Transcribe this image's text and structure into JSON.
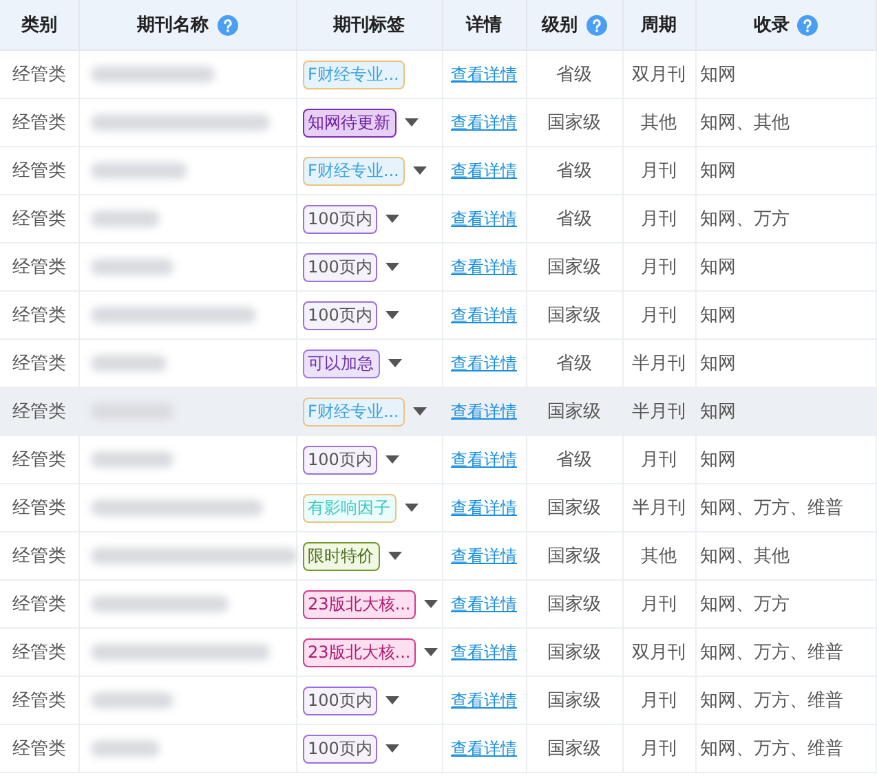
{
  "columns": [
    {
      "label": "类别",
      "help": false
    },
    {
      "label": "期刊名称",
      "help": true
    },
    {
      "label": "期刊标签",
      "help": false
    },
    {
      "label": "详情",
      "help": false
    },
    {
      "label": "级别",
      "help": true
    },
    {
      "label": "周期",
      "help": false
    },
    {
      "label": "收录",
      "help": true
    }
  ],
  "rows": [
    {
      "category": "经管类",
      "tag": {
        "text": "F财经专业...",
        "kind": "finance",
        "menu": false
      },
      "detail": "查看详情",
      "level": "省级",
      "period": "双月刊",
      "index": "知网",
      "hovered": false
    },
    {
      "category": "经管类",
      "tag": {
        "text": "知网待更新",
        "kind": "update",
        "menu": true
      },
      "detail": "查看详情",
      "level": "国家级",
      "period": "其他",
      "index": "知网、其他",
      "hovered": false
    },
    {
      "category": "经管类",
      "tag": {
        "text": "F财经专业...",
        "kind": "finance",
        "menu": true
      },
      "detail": "查看详情",
      "level": "省级",
      "period": "月刊",
      "index": "知网",
      "hovered": false
    },
    {
      "category": "经管类",
      "tag": {
        "text": "100页内",
        "kind": "pages",
        "menu": true
      },
      "detail": "查看详情",
      "level": "省级",
      "period": "月刊",
      "index": "知网、万方",
      "hovered": false
    },
    {
      "category": "经管类",
      "tag": {
        "text": "100页内",
        "kind": "pages",
        "menu": true
      },
      "detail": "查看详情",
      "level": "国家级",
      "period": "月刊",
      "index": "知网",
      "hovered": false
    },
    {
      "category": "经管类",
      "tag": {
        "text": "100页内",
        "kind": "pages",
        "menu": true
      },
      "detail": "查看详情",
      "level": "国家级",
      "period": "月刊",
      "index": "知网",
      "hovered": false
    },
    {
      "category": "经管类",
      "tag": {
        "text": "可以加急",
        "kind": "urgent",
        "menu": true
      },
      "detail": "查看详情",
      "level": "省级",
      "period": "半月刊",
      "index": "知网",
      "hovered": false
    },
    {
      "category": "经管类",
      "tag": {
        "text": "F财经专业...",
        "kind": "finance",
        "menu": true
      },
      "detail": "查看详情",
      "level": "国家级",
      "period": "半月刊",
      "index": "知网",
      "hovered": true
    },
    {
      "category": "经管类",
      "tag": {
        "text": "100页内",
        "kind": "pages",
        "menu": true
      },
      "detail": "查看详情",
      "level": "省级",
      "period": "月刊",
      "index": "知网",
      "hovered": false
    },
    {
      "category": "经管类",
      "tag": {
        "text": "有影响因子",
        "kind": "impact",
        "menu": true
      },
      "detail": "查看详情",
      "level": "国家级",
      "period": "半月刊",
      "index": "知网、万方、维普",
      "hovered": false
    },
    {
      "category": "经管类",
      "tag": {
        "text": "限时特价",
        "kind": "sale",
        "menu": true
      },
      "detail": "查看详情",
      "level": "国家级",
      "period": "其他",
      "index": "知网、其他",
      "hovered": false
    },
    {
      "category": "经管类",
      "tag": {
        "text": "23版北大核...",
        "kind": "core",
        "menu": true
      },
      "detail": "查看详情",
      "level": "国家级",
      "period": "月刊",
      "index": "知网、万方",
      "hovered": false
    },
    {
      "category": "经管类",
      "tag": {
        "text": "23版北大核...",
        "kind": "core",
        "menu": true
      },
      "detail": "查看详情",
      "level": "国家级",
      "period": "双月刊",
      "index": "知网、万方、维普",
      "hovered": false
    },
    {
      "category": "经管类",
      "tag": {
        "text": "100页内",
        "kind": "pages",
        "menu": true
      },
      "detail": "查看详情",
      "level": "国家级",
      "period": "月刊",
      "index": "知网、万方、维普",
      "hovered": false
    },
    {
      "category": "经管类",
      "tag": {
        "text": "100页内",
        "kind": "pages",
        "menu": true
      },
      "detail": "查看详情",
      "level": "国家级",
      "period": "月刊",
      "index": "知网、万方、维普",
      "hovered": false
    }
  ]
}
